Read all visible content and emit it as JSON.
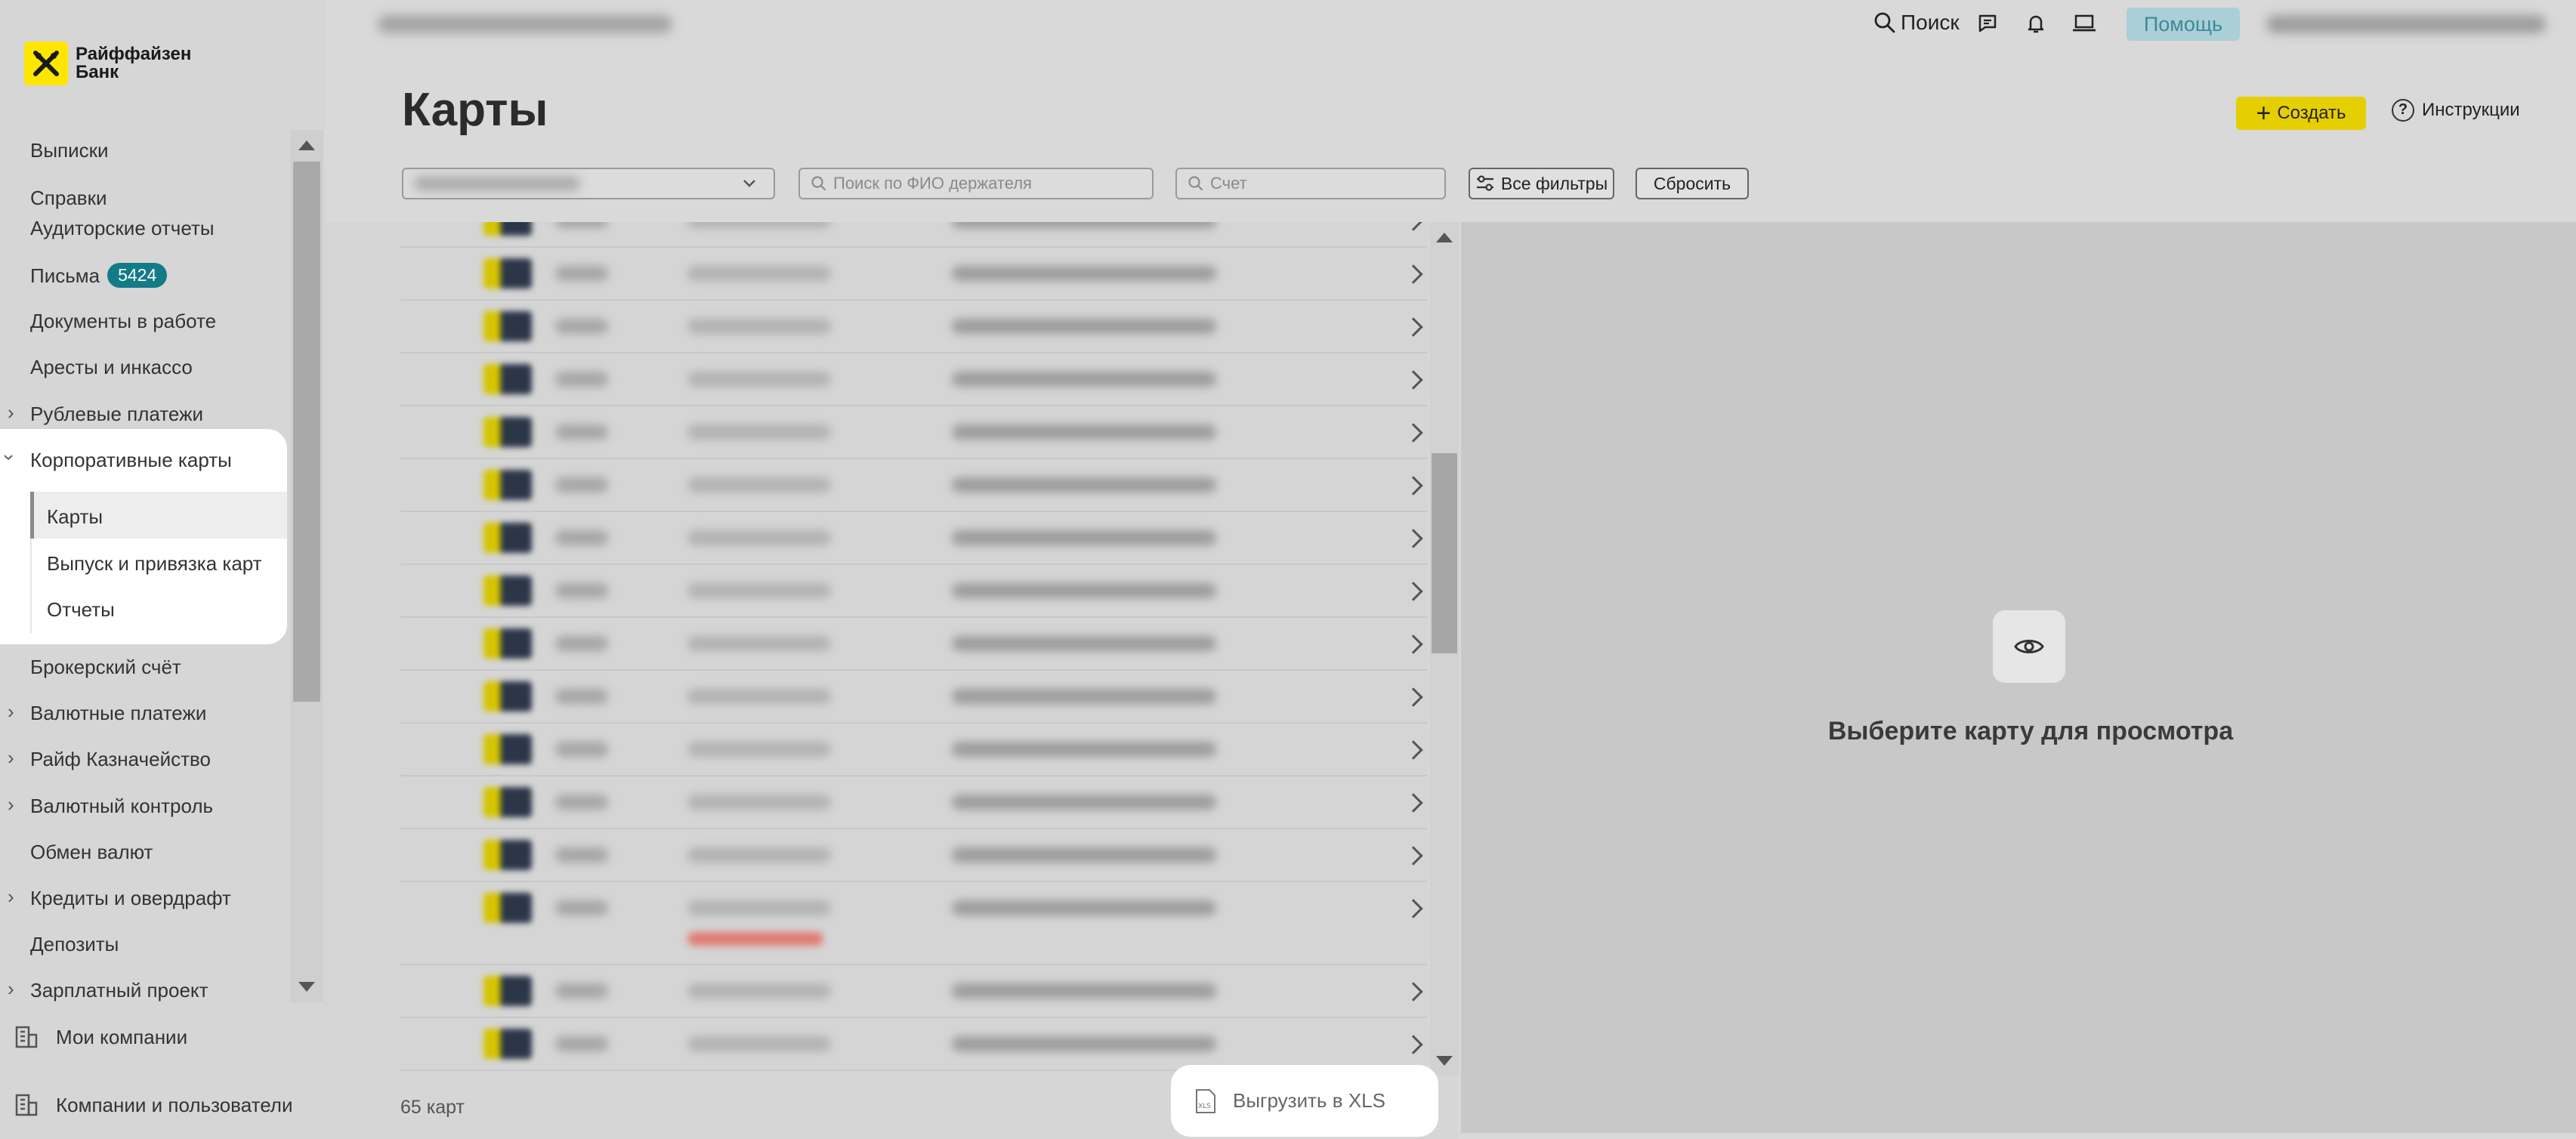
{
  "logo": {
    "line1": "Райффайзен",
    "line2": "Банк",
    "brand_color": "#fee600"
  },
  "sidebar": {
    "items": [
      {
        "label": "Выписки",
        "has_chevron": false
      },
      {
        "label": "Справки",
        "has_chevron": false
      },
      {
        "label": "Аудиторские отчеты",
        "has_chevron": false
      },
      {
        "label": "Письма",
        "has_chevron": false,
        "badge": "5424"
      },
      {
        "label": "Документы в работе",
        "has_chevron": false
      },
      {
        "label": "Аресты и инкассо",
        "has_chevron": false
      },
      {
        "label": "Рублевые платежи",
        "has_chevron": true,
        "expanded": false
      },
      {
        "label": "Корпоративные карты",
        "has_chevron": true,
        "expanded": true
      },
      {
        "label": "Брокерский счёт",
        "has_chevron": false
      },
      {
        "label": "Валютные платежи",
        "has_chevron": true,
        "expanded": false
      },
      {
        "label": "Райф Казначейство",
        "has_chevron": true,
        "expanded": false
      },
      {
        "label": "Валютный контроль",
        "has_chevron": true,
        "expanded": false
      },
      {
        "label": "Обмен валют",
        "has_chevron": false
      },
      {
        "label": "Кредиты и овердрафт",
        "has_chevron": true,
        "expanded": false
      },
      {
        "label": "Депозиты",
        "has_chevron": false
      },
      {
        "label": "Зарплатный проект",
        "has_chevron": true,
        "expanded": false
      }
    ],
    "subitems": [
      {
        "label": "Карты",
        "selected": true
      },
      {
        "label": "Выпуск и привязка карт",
        "selected": false
      },
      {
        "label": "Отчеты",
        "selected": false
      }
    ],
    "bottom": {
      "my_companies": "Мои компании",
      "companies_users": "Компании и пользователи"
    },
    "badge_color": "#127b87"
  },
  "topbar": {
    "search_label": "Поиск",
    "help_label": "Помощь"
  },
  "page": {
    "title": "Карты",
    "create_label": "Создать",
    "instructions_label": "Инструкции"
  },
  "filters": {
    "holder_placeholder": "Поиск по ФИО держателя",
    "account_placeholder": "Счет",
    "all_filters_label": "Все фильтры",
    "reset_label": "Сбросить"
  },
  "list": {
    "footer_count": "65 карт",
    "export_label": "Выгрузить в XLS"
  },
  "preview": {
    "empty_text": "Выберите карту для просмотра"
  }
}
